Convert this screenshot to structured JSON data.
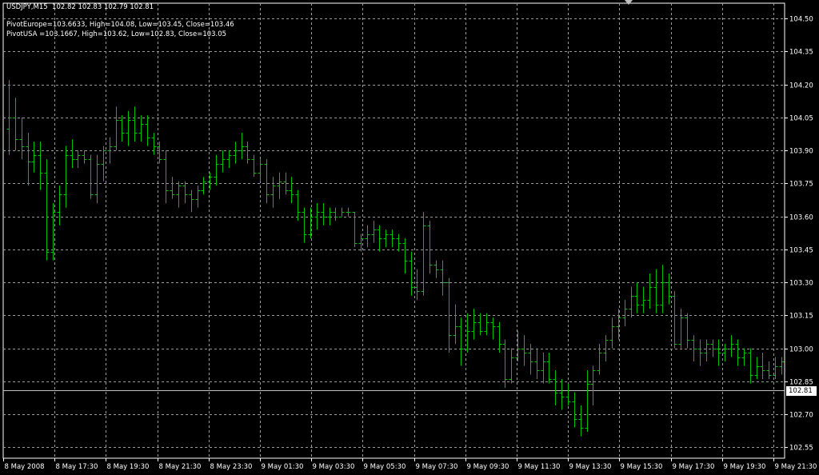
{
  "header": {
    "symbol_line": "USDJPY,M15  102.82 102.83 102.79 102.81",
    "pivot_europe": "PivotEurope=103.6633, High=104.08, Low=103.45, Close=103.46",
    "pivot_usa": "PivotUSA =103.1667, High=103.62, Low=102.83, Close=103.05"
  },
  "current_price": "102.81",
  "colors": {
    "background": "#000000",
    "grid": "#9a9a9a",
    "bars": "#00c000",
    "axis_text": "#ffffff"
  },
  "chart_data": {
    "type": "bar",
    "subtype": "ohlc",
    "symbol": "USDJPY",
    "timeframe": "M15",
    "grid": true,
    "ylim": [
      102.5,
      104.57
    ],
    "y_ticks": [
      "104.50",
      "104.35",
      "104.20",
      "104.05",
      "103.90",
      "103.75",
      "103.60",
      "103.45",
      "103.30",
      "103.15",
      "103.00",
      "102.85",
      "102.70",
      "102.55"
    ],
    "x_ticks": [
      "8 May 2008",
      "8 May 17:30",
      "8 May 19:30",
      "8 May 21:30",
      "8 May 23:30",
      "9 May 01:30",
      "9 May 03:30",
      "9 May 05:30",
      "9 May 07:30",
      "9 May 09:30",
      "9 May 11:30",
      "9 May 13:30",
      "9 May 15:30",
      "9 May 17:30",
      "9 May 19:30",
      "9 May 21:30"
    ],
    "bars": [
      {
        "o": 104.0,
        "h": 104.22,
        "l": 103.88,
        "c": 104.05
      },
      {
        "o": 104.05,
        "h": 104.14,
        "l": 103.9,
        "c": 103.95
      },
      {
        "o": 103.95,
        "h": 104.05,
        "l": 103.86,
        "c": 103.92
      },
      {
        "o": 103.92,
        "h": 103.98,
        "l": 103.74,
        "c": 103.85
      },
      {
        "o": 103.85,
        "h": 103.94,
        "l": 103.8,
        "c": 103.88
      },
      {
        "o": 103.88,
        "h": 103.94,
        "l": 103.72,
        "c": 103.8
      },
      {
        "o": 103.8,
        "h": 103.86,
        "l": 103.4,
        "c": 103.44
      },
      {
        "o": 103.44,
        "h": 103.66,
        "l": 103.4,
        "c": 103.62
      },
      {
        "o": 103.62,
        "h": 103.74,
        "l": 103.56,
        "c": 103.7
      },
      {
        "o": 103.7,
        "h": 103.92,
        "l": 103.64,
        "c": 103.88
      },
      {
        "o": 103.88,
        "h": 103.95,
        "l": 103.82,
        "c": 103.86
      },
      {
        "o": 103.86,
        "h": 103.9,
        "l": 103.82,
        "c": 103.88
      },
      {
        "o": 103.88,
        "h": 103.9,
        "l": 103.84,
        "c": 103.86
      },
      {
        "o": 103.86,
        "h": 103.88,
        "l": 103.68,
        "c": 103.7
      },
      {
        "o": 103.7,
        "h": 103.88,
        "l": 103.66,
        "c": 103.84
      },
      {
        "o": 103.84,
        "h": 103.92,
        "l": 103.76,
        "c": 103.9
      },
      {
        "o": 103.9,
        "h": 103.96,
        "l": 103.84,
        "c": 103.92
      },
      {
        "o": 103.92,
        "h": 104.1,
        "l": 103.9,
        "c": 104.04
      },
      {
        "o": 104.04,
        "h": 104.06,
        "l": 103.94,
        "c": 103.98
      },
      {
        "o": 103.98,
        "h": 104.08,
        "l": 103.92,
        "c": 104.04
      },
      {
        "o": 104.04,
        "h": 104.1,
        "l": 103.94,
        "c": 103.98
      },
      {
        "o": 103.98,
        "h": 104.06,
        "l": 103.94,
        "c": 104.02
      },
      {
        "o": 104.02,
        "h": 104.06,
        "l": 103.92,
        "c": 103.96
      },
      {
        "o": 103.96,
        "h": 103.98,
        "l": 103.88,
        "c": 103.92
      },
      {
        "o": 103.92,
        "h": 103.94,
        "l": 103.84,
        "c": 103.86
      },
      {
        "o": 103.86,
        "h": 103.9,
        "l": 103.66,
        "c": 103.72
      },
      {
        "o": 103.72,
        "h": 103.78,
        "l": 103.68,
        "c": 103.7
      },
      {
        "o": 103.7,
        "h": 103.76,
        "l": 103.64,
        "c": 103.74
      },
      {
        "o": 103.74,
        "h": 103.76,
        "l": 103.66,
        "c": 103.7
      },
      {
        "o": 103.7,
        "h": 103.72,
        "l": 103.62,
        "c": 103.68
      },
      {
        "o": 103.68,
        "h": 103.74,
        "l": 103.64,
        "c": 103.72
      },
      {
        "o": 103.72,
        "h": 103.78,
        "l": 103.7,
        "c": 103.76
      },
      {
        "o": 103.76,
        "h": 103.8,
        "l": 103.72,
        "c": 103.78
      },
      {
        "o": 103.78,
        "h": 103.88,
        "l": 103.74,
        "c": 103.84
      },
      {
        "o": 103.84,
        "h": 103.9,
        "l": 103.8,
        "c": 103.86
      },
      {
        "o": 103.86,
        "h": 103.9,
        "l": 103.82,
        "c": 103.88
      },
      {
        "o": 103.88,
        "h": 103.94,
        "l": 103.84,
        "c": 103.9
      },
      {
        "o": 103.9,
        "h": 103.98,
        "l": 103.86,
        "c": 103.92
      },
      {
        "o": 103.92,
        "h": 103.94,
        "l": 103.84,
        "c": 103.86
      },
      {
        "o": 103.86,
        "h": 103.88,
        "l": 103.78,
        "c": 103.8
      },
      {
        "o": 103.8,
        "h": 103.86,
        "l": 103.76,
        "c": 103.84
      },
      {
        "o": 103.84,
        "h": 103.86,
        "l": 103.66,
        "c": 103.7
      },
      {
        "o": 103.7,
        "h": 103.78,
        "l": 103.64,
        "c": 103.74
      },
      {
        "o": 103.74,
        "h": 103.8,
        "l": 103.68,
        "c": 103.76
      },
      {
        "o": 103.76,
        "h": 103.8,
        "l": 103.7,
        "c": 103.72
      },
      {
        "o": 103.72,
        "h": 103.78,
        "l": 103.66,
        "c": 103.7
      },
      {
        "o": 103.7,
        "h": 103.72,
        "l": 103.58,
        "c": 103.62
      },
      {
        "o": 103.62,
        "h": 103.64,
        "l": 103.48,
        "c": 103.52
      },
      {
        "o": 103.52,
        "h": 103.64,
        "l": 103.5,
        "c": 103.6
      },
      {
        "o": 103.6,
        "h": 103.66,
        "l": 103.54,
        "c": 103.62
      },
      {
        "o": 103.62,
        "h": 103.66,
        "l": 103.56,
        "c": 103.6
      },
      {
        "o": 103.6,
        "h": 103.64,
        "l": 103.56,
        "c": 103.62
      },
      {
        "o": 103.62,
        "h": 103.64,
        "l": 103.58,
        "c": 103.6
      },
      {
        "o": 103.6,
        "h": 103.64,
        "l": 103.6,
        "c": 103.62
      },
      {
        "o": 103.62,
        "h": 103.64,
        "l": 103.6,
        "c": 103.62
      },
      {
        "o": 103.62,
        "h": 103.62,
        "l": 103.46,
        "c": 103.48
      },
      {
        "o": 103.48,
        "h": 103.52,
        "l": 103.44,
        "c": 103.5
      },
      {
        "o": 103.5,
        "h": 103.56,
        "l": 103.46,
        "c": 103.52
      },
      {
        "o": 103.52,
        "h": 103.58,
        "l": 103.48,
        "c": 103.54
      },
      {
        "o": 103.54,
        "h": 103.56,
        "l": 103.44,
        "c": 103.5
      },
      {
        "o": 103.5,
        "h": 103.54,
        "l": 103.46,
        "c": 103.52
      },
      {
        "o": 103.52,
        "h": 103.54,
        "l": 103.46,
        "c": 103.5
      },
      {
        "o": 103.5,
        "h": 103.52,
        "l": 103.44,
        "c": 103.48
      },
      {
        "o": 103.48,
        "h": 103.5,
        "l": 103.34,
        "c": 103.4
      },
      {
        "o": 103.4,
        "h": 103.44,
        "l": 103.24,
        "c": 103.28
      },
      {
        "o": 103.28,
        "h": 103.36,
        "l": 103.22,
        "c": 103.26
      },
      {
        "o": 103.26,
        "h": 103.62,
        "l": 103.24,
        "c": 103.56
      },
      {
        "o": 103.56,
        "h": 103.58,
        "l": 103.34,
        "c": 103.38
      },
      {
        "o": 103.38,
        "h": 103.4,
        "l": 103.32,
        "c": 103.36
      },
      {
        "o": 103.36,
        "h": 103.4,
        "l": 103.24,
        "c": 103.3
      },
      {
        "o": 103.3,
        "h": 103.32,
        "l": 102.98,
        "c": 103.06
      },
      {
        "o": 103.06,
        "h": 103.2,
        "l": 103.02,
        "c": 103.1
      },
      {
        "o": 103.1,
        "h": 103.14,
        "l": 102.92,
        "c": 103.0
      },
      {
        "o": 103.0,
        "h": 103.16,
        "l": 102.98,
        "c": 103.08
      },
      {
        "o": 103.08,
        "h": 103.18,
        "l": 103.04,
        "c": 103.12
      },
      {
        "o": 103.12,
        "h": 103.16,
        "l": 103.06,
        "c": 103.08
      },
      {
        "o": 103.08,
        "h": 103.16,
        "l": 103.06,
        "c": 103.12
      },
      {
        "o": 103.12,
        "h": 103.14,
        "l": 103.04,
        "c": 103.1
      },
      {
        "o": 103.1,
        "h": 103.12,
        "l": 102.98,
        "c": 103.02
      },
      {
        "o": 103.02,
        "h": 103.04,
        "l": 102.82,
        "c": 102.86
      },
      {
        "o": 102.86,
        "h": 103.0,
        "l": 102.84,
        "c": 102.96
      },
      {
        "o": 102.96,
        "h": 103.08,
        "l": 102.94,
        "c": 103.0
      },
      {
        "o": 103.0,
        "h": 103.06,
        "l": 102.92,
        "c": 102.98
      },
      {
        "o": 102.98,
        "h": 103.02,
        "l": 102.88,
        "c": 102.94
      },
      {
        "o": 102.94,
        "h": 103.0,
        "l": 102.86,
        "c": 102.9
      },
      {
        "o": 102.9,
        "h": 102.98,
        "l": 102.84,
        "c": 102.94
      },
      {
        "o": 102.94,
        "h": 102.98,
        "l": 102.84,
        "c": 102.86
      },
      {
        "o": 102.86,
        "h": 102.9,
        "l": 102.74,
        "c": 102.8
      },
      {
        "o": 102.8,
        "h": 102.86,
        "l": 102.72,
        "c": 102.78
      },
      {
        "o": 102.78,
        "h": 102.84,
        "l": 102.74,
        "c": 102.76
      },
      {
        "o": 102.76,
        "h": 102.8,
        "l": 102.64,
        "c": 102.68
      },
      {
        "o": 102.68,
        "h": 102.74,
        "l": 102.6,
        "c": 102.64
      },
      {
        "o": 102.64,
        "h": 102.9,
        "l": 102.62,
        "c": 102.84
      },
      {
        "o": 102.84,
        "h": 102.92,
        "l": 102.74,
        "c": 102.9
      },
      {
        "o": 102.9,
        "h": 103.02,
        "l": 102.88,
        "c": 102.98
      },
      {
        "o": 102.98,
        "h": 103.06,
        "l": 102.94,
        "c": 103.04
      },
      {
        "o": 103.04,
        "h": 103.14,
        "l": 103.0,
        "c": 103.1
      },
      {
        "o": 103.1,
        "h": 103.18,
        "l": 103.04,
        "c": 103.14
      },
      {
        "o": 103.14,
        "h": 103.22,
        "l": 103.1,
        "c": 103.18
      },
      {
        "o": 103.18,
        "h": 103.28,
        "l": 103.14,
        "c": 103.24
      },
      {
        "o": 103.24,
        "h": 103.3,
        "l": 103.16,
        "c": 103.2
      },
      {
        "o": 103.2,
        "h": 103.28,
        "l": 103.16,
        "c": 103.22
      },
      {
        "o": 103.22,
        "h": 103.34,
        "l": 103.18,
        "c": 103.28
      },
      {
        "o": 103.28,
        "h": 103.36,
        "l": 103.16,
        "c": 103.2
      },
      {
        "o": 103.2,
        "h": 103.38,
        "l": 103.16,
        "c": 103.3
      },
      {
        "o": 103.3,
        "h": 103.34,
        "l": 103.2,
        "c": 103.24
      },
      {
        "o": 103.24,
        "h": 103.26,
        "l": 103.0,
        "c": 103.02
      },
      {
        "o": 103.02,
        "h": 103.18,
        "l": 103.0,
        "c": 103.14
      },
      {
        "o": 103.14,
        "h": 103.16,
        "l": 103.0,
        "c": 103.04
      },
      {
        "o": 103.04,
        "h": 103.06,
        "l": 102.94,
        "c": 103.0
      },
      {
        "o": 103.0,
        "h": 103.04,
        "l": 102.92,
        "c": 102.98
      },
      {
        "o": 102.98,
        "h": 103.04,
        "l": 102.94,
        "c": 103.02
      },
      {
        "o": 103.02,
        "h": 103.04,
        "l": 102.96,
        "c": 103.0
      },
      {
        "o": 103.0,
        "h": 103.04,
        "l": 102.92,
        "c": 102.98
      },
      {
        "o": 102.98,
        "h": 103.02,
        "l": 102.94,
        "c": 103.0
      },
      {
        "o": 103.0,
        "h": 103.06,
        "l": 102.96,
        "c": 103.02
      },
      {
        "o": 103.02,
        "h": 103.04,
        "l": 102.92,
        "c": 102.96
      },
      {
        "o": 102.96,
        "h": 103.0,
        "l": 102.92,
        "c": 102.98
      },
      {
        "o": 102.98,
        "h": 103.0,
        "l": 102.84,
        "c": 102.88
      },
      {
        "o": 102.88,
        "h": 102.96,
        "l": 102.86,
        "c": 102.92
      },
      {
        "o": 102.92,
        "h": 102.98,
        "l": 102.86,
        "c": 102.9
      },
      {
        "o": 102.9,
        "h": 102.94,
        "l": 102.86,
        "c": 102.88
      },
      {
        "o": 102.88,
        "h": 102.96,
        "l": 102.86,
        "c": 102.92
      },
      {
        "o": 102.92,
        "h": 102.96,
        "l": 102.88,
        "c": 102.94
      }
    ]
  }
}
